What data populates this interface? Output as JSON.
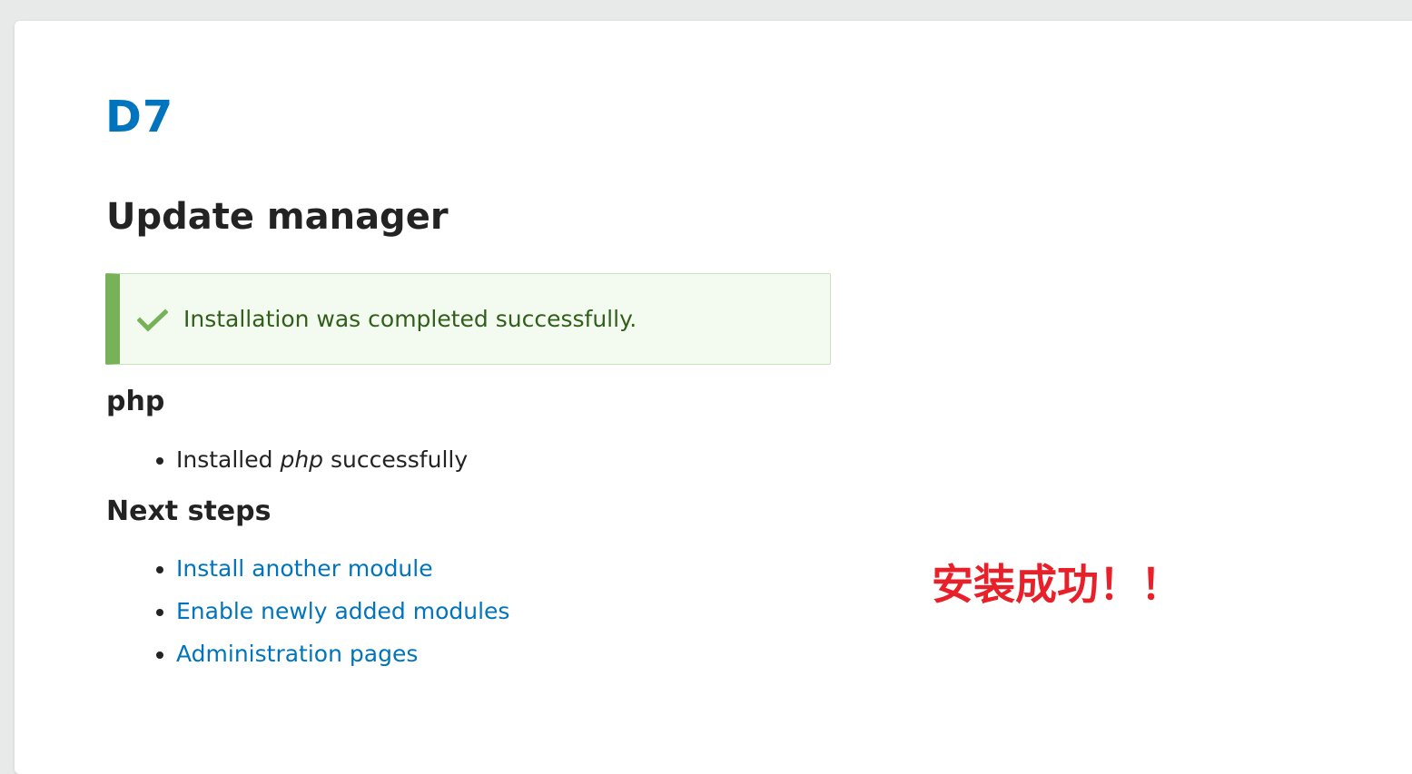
{
  "site": {
    "name": "D7"
  },
  "page": {
    "title": "Update manager"
  },
  "status": {
    "message": "Installation was completed successfully.",
    "icon": "checkmark-icon",
    "colors": {
      "accent": "#77b259",
      "background": "#f3faef",
      "text": "#325e1c"
    }
  },
  "project": {
    "title": "php",
    "result": {
      "prefix": "Installed",
      "name": "php",
      "suffix": "successfully"
    }
  },
  "next_steps": {
    "title": "Next steps",
    "links": [
      {
        "label": "Install another module"
      },
      {
        "label": "Enable newly added modules"
      },
      {
        "label": "Administration pages"
      }
    ]
  },
  "annotation": {
    "text": "安装成功！！",
    "color": "#e8202a"
  },
  "theme": {
    "link_color": "#0074bd",
    "text_color": "#232323"
  }
}
